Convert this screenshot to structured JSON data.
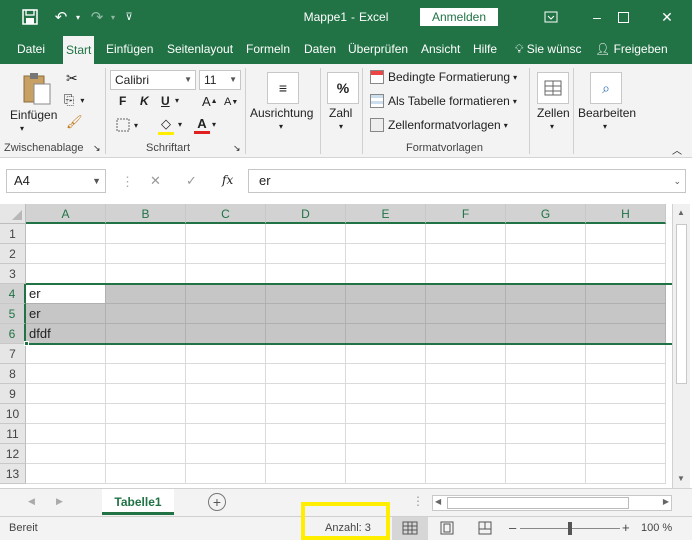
{
  "app": {
    "title": "Mappe1",
    "sep": "-",
    "app_name": "Excel",
    "signin": "Anmelden"
  },
  "tabs": [
    "Datei",
    "Start",
    "Einfügen",
    "Seitenlayout",
    "Formeln",
    "Daten",
    "Überprüfen",
    "Ansicht",
    "Hilfe",
    "Sie wünsc",
    "Freigeben"
  ],
  "ribbon": {
    "paste": "Einfügen",
    "clipboard": "Zwischenablage",
    "font_name": "Calibri",
    "font_size": "11",
    "bold": "F",
    "italic": "K",
    "underline": "U",
    "font_group": "Schriftart",
    "align": "Ausrichtung",
    "number": "Zahl",
    "number_icon": "%",
    "cond_format": "Bedingte Formatierung",
    "as_table": "Als Tabelle formatieren",
    "cell_styles": "Zellenformatvorlagen",
    "styles_group": "Formatvorlagen",
    "cells": "Zellen",
    "edit": "Bearbeiten"
  },
  "formula_bar": {
    "name_box": "A4",
    "fx": "fx",
    "content": "er"
  },
  "columns": [
    "A",
    "B",
    "C",
    "D",
    "E",
    "F",
    "G",
    "H"
  ],
  "rows": [
    "1",
    "2",
    "3",
    "4",
    "5",
    "6",
    "7",
    "8",
    "9",
    "10",
    "11",
    "12",
    "13"
  ],
  "cells": {
    "A4": "er",
    "A5": "er",
    "A6": "dfdf"
  },
  "sheet": {
    "name": "Tabelle1"
  },
  "status": {
    "ready": "Bereit",
    "count": "Anzahl: 3",
    "zoom": "100 %",
    "zoom_level": 100
  },
  "colors": {
    "accent": "#217346",
    "highlight": "#ffee00",
    "selection": "#c6c6c6"
  }
}
